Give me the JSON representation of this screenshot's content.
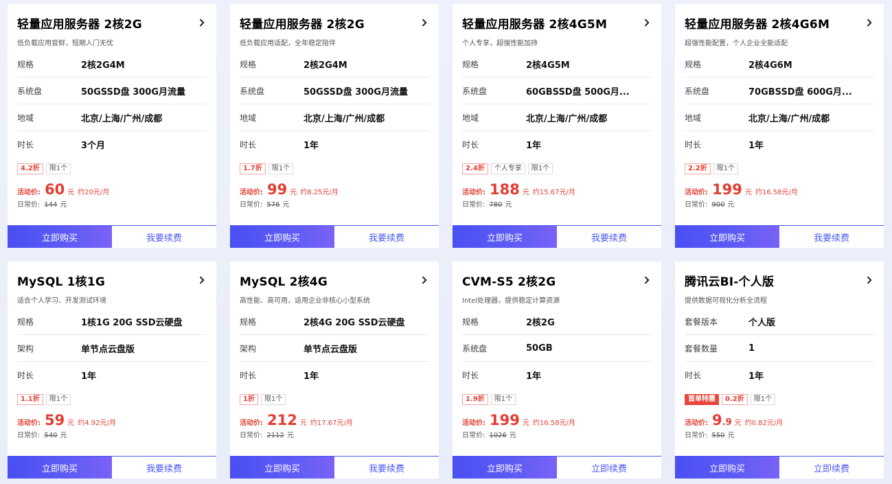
{
  "labels": {
    "price_label": "活动价:",
    "orig_label": "日常价:",
    "yuan": "元"
  },
  "cards": [
    {
      "title": "轻量应用服务器 2核2G",
      "subtitle": "低负载应用尝鲜，短期入门无忧",
      "specs": [
        {
          "k": "规格",
          "v": "2核2G4M"
        },
        {
          "k": "系统盘",
          "v": "50GSSD盘 300G月流量"
        },
        {
          "k": "地域",
          "v": "北京/上海/广州/成都"
        },
        {
          "k": "时长",
          "v": "3个月"
        }
      ],
      "tags": [
        {
          "t": "4.2折",
          "s": "red"
        },
        {
          "t": "限1个",
          "s": ""
        }
      ],
      "price_int": "60",
      "price_dec": "",
      "monthly": "约20元/月",
      "orig": "144",
      "buy": "立即购买",
      "renew": "我要续费"
    },
    {
      "title": "轻量应用服务器 2核2G",
      "subtitle": "低负载应用适配，全年稳定陪伴",
      "specs": [
        {
          "k": "规格",
          "v": "2核2G4M"
        },
        {
          "k": "系统盘",
          "v": "50GSSD盘 300G月流量"
        },
        {
          "k": "地域",
          "v": "北京/上海/广州/成都"
        },
        {
          "k": "时长",
          "v": "1年"
        }
      ],
      "tags": [
        {
          "t": "1.7折",
          "s": "red"
        },
        {
          "t": "限1个",
          "s": ""
        }
      ],
      "price_int": "99",
      "price_dec": "",
      "monthly": "约8.25元/月",
      "orig": "576",
      "buy": "立即购买",
      "renew": "我要续费"
    },
    {
      "title": "轻量应用服务器 2核4G5M",
      "subtitle": "个人专享，超强性能加持",
      "specs": [
        {
          "k": "规格",
          "v": "2核4G5M"
        },
        {
          "k": "系统盘",
          "v": "60GBSSD盘 500G月..."
        },
        {
          "k": "地域",
          "v": "北京/上海/广州/成都"
        },
        {
          "k": "时长",
          "v": "1年"
        }
      ],
      "tags": [
        {
          "t": "2.4折",
          "s": "red"
        },
        {
          "t": "个人专享",
          "s": ""
        },
        {
          "t": "限1个",
          "s": ""
        }
      ],
      "price_int": "188",
      "price_dec": "",
      "monthly": "约15.67元/月",
      "orig": "780",
      "buy": "立即购买",
      "renew": "我要续费"
    },
    {
      "title": "轻量应用服务器 2核4G6M",
      "subtitle": "超强性能配置，个人企业全能适配",
      "specs": [
        {
          "k": "规格",
          "v": "2核4G6M"
        },
        {
          "k": "系统盘",
          "v": "70GBSSD盘 600G月..."
        },
        {
          "k": "地域",
          "v": "北京/上海/广州/成都"
        },
        {
          "k": "时长",
          "v": "1年"
        }
      ],
      "tags": [
        {
          "t": "2.2折",
          "s": "red"
        },
        {
          "t": "限1个",
          "s": ""
        }
      ],
      "price_int": "199",
      "price_dec": "",
      "monthly": "约16.58元/月",
      "orig": "900",
      "buy": "立即购买",
      "renew": "我要续费"
    },
    {
      "title": "MySQL 1核1G",
      "subtitle": "适合个人学习、开发测试环境",
      "specs": [
        {
          "k": "规格",
          "v": "1核1G 20G SSD云硬盘"
        },
        {
          "k": "架构",
          "v": "单节点云盘版"
        },
        {
          "k": "时长",
          "v": "1年"
        }
      ],
      "tags": [
        {
          "t": "1.1折",
          "s": "red"
        },
        {
          "t": "限1个",
          "s": ""
        }
      ],
      "price_int": "59",
      "price_dec": "",
      "monthly": "约4.92元/月",
      "orig": "540",
      "buy": "立即购买",
      "renew": "我要续费"
    },
    {
      "title": "MySQL 2核4G",
      "subtitle": "高性能、高可用，适用企业非核心小型系统",
      "specs": [
        {
          "k": "规格",
          "v": "2核4G 20G SSD云硬盘"
        },
        {
          "k": "架构",
          "v": "单节点云盘版"
        },
        {
          "k": "时长",
          "v": "1年"
        }
      ],
      "tags": [
        {
          "t": "1折",
          "s": "red"
        },
        {
          "t": "限1个",
          "s": ""
        }
      ],
      "price_int": "212",
      "price_dec": "",
      "monthly": "约17.67元/月",
      "orig": "2112",
      "buy": "立即购买",
      "renew": "我要续费"
    },
    {
      "title": "CVM-S5 2核2G",
      "subtitle": "Intel处理器，提供稳定计算资源",
      "specs": [
        {
          "k": "规格",
          "v": "2核2G"
        },
        {
          "k": "系统盘",
          "v": "50GB"
        },
        {
          "k": "时长",
          "v": "1年"
        }
      ],
      "tags": [
        {
          "t": "1.9折",
          "s": "red"
        },
        {
          "t": "限1个",
          "s": ""
        }
      ],
      "price_int": "199",
      "price_dec": "",
      "monthly": "约16.58元/月",
      "orig": "1026",
      "buy": "立即购买",
      "renew": "立即续费"
    },
    {
      "title": "腾讯云BI-个人版",
      "subtitle": "提供数据可视化分析全流程",
      "specs": [
        {
          "k": "套餐版本",
          "v": "个人版"
        },
        {
          "k": "套餐数量",
          "v": "1"
        },
        {
          "k": "时长",
          "v": "1年"
        }
      ],
      "tags": [
        {
          "t": "首单特惠",
          "s": "fill"
        },
        {
          "t": "0.2折",
          "s": "red"
        },
        {
          "t": "限1个",
          "s": ""
        }
      ],
      "price_int": "9",
      "price_dec": ".9",
      "monthly": "约0.82元/月",
      "orig": "550",
      "buy": "立即购买",
      "renew": "立即续费"
    }
  ]
}
